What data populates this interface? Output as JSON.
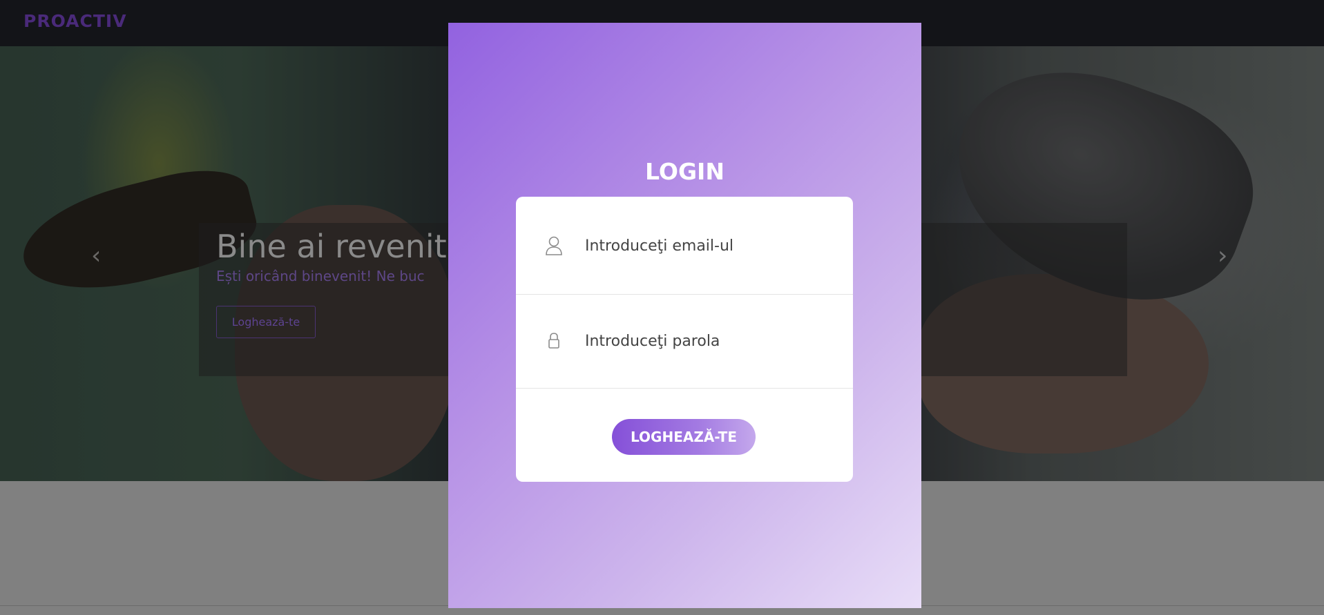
{
  "navbar": {
    "logo_text": "PROACTIV"
  },
  "hero": {
    "title": "Bine ai revenit!",
    "subtitle": "Ești oricând binevenit! Ne buc",
    "button_label": "Loghează-te",
    "prev_arrow": "‹",
    "next_arrow": "›"
  },
  "modal": {
    "title": "LOGIN",
    "email_placeholder": "Introduceţi email-ul",
    "password_placeholder": "Introduceţi parola",
    "submit_label": "LOGHEAZĂ-TE",
    "email_icon": "user-icon",
    "password_icon": "lock-icon"
  },
  "colors": {
    "accent": "#8550d8",
    "navbar": "#131418",
    "overlay": "#808080"
  }
}
